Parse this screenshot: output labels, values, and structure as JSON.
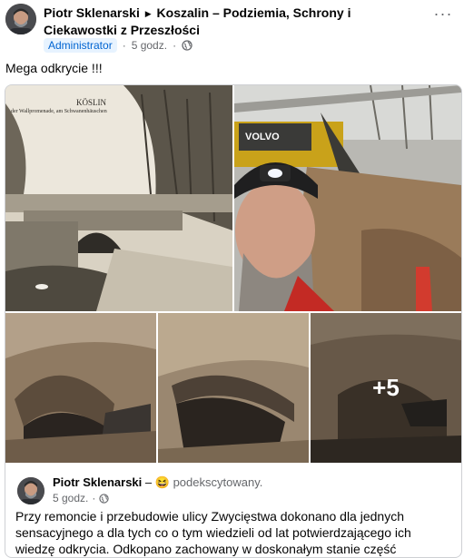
{
  "post": {
    "author": "Piotr Sklenarski",
    "group": "Koszalin – Podziemia, Schrony i Ciekawostki z Przeszłości",
    "role_badge": "Administrator",
    "time": "5 godz.",
    "separator": "·",
    "more_icon": "more-dots-icon",
    "privacy_icon": "globe-icon",
    "text": "Mega odkrycie !!!"
  },
  "gallery": {
    "postcard_title": "KÖSLIN",
    "postcard_caption": "der Wallpromenade, am Schwanenhäuschen",
    "more_count": "+5",
    "volvo_text": "VOLVO"
  },
  "shared": {
    "author": "Piotr Sklenarski",
    "dash": "–",
    "feeling_emoji": "😆",
    "feeling": "podekscytowany.",
    "time": "5 godz.",
    "separator": "·",
    "text": "Przy remoncie i przebudowie ulicy Zwycięstwa dokonano dla jednych sensacyjnego a dla tych co o tym wiedzieli od lat potwierdzającego ich wiedzę odkrycia. Odkopano zachowany w doskonałym stanie część"
  },
  "colors": {
    "admin_bg": "#e7f3ff",
    "admin_text": "#0064d1",
    "meta": "#65676b"
  }
}
